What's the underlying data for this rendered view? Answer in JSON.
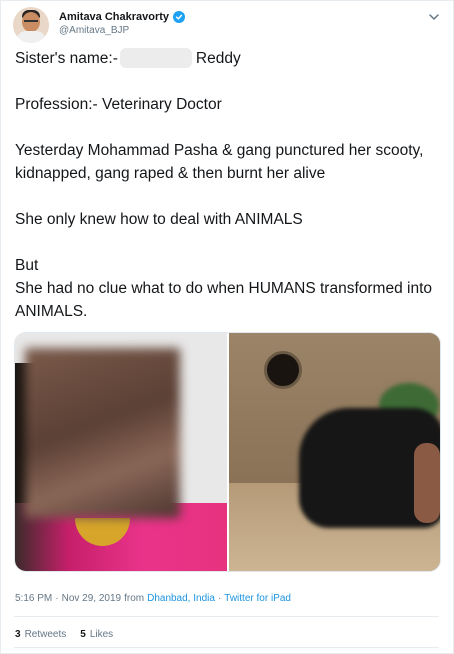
{
  "tweet": {
    "author": {
      "display_name": "Amitava Chakravorty",
      "handle": "@Amitava_BJP",
      "verified": true
    },
    "text": {
      "line1_prefix": "Sister's name:-",
      "line1_suffix": "Reddy",
      "line2": "Profession:- Veterinary Doctor",
      "line3": "Yesterday Mohammad Pasha & gang punctured her scooty, kidnapped, gang raped & then burnt her alive",
      "line4": "She only knew how to deal with ANIMALS",
      "line5": "But",
      "line6": "She had no clue what to do when HUMANS transformed into ANIMALS."
    },
    "meta": {
      "time": "5:16 PM",
      "date": "Nov 29, 2019",
      "from_label": "from",
      "location": "Dhanbad, India",
      "source": "Twitter for iPad"
    },
    "stats": {
      "retweets_count": "3",
      "retweets_label": "Retweets",
      "likes_count": "5",
      "likes_label": "Likes"
    }
  },
  "colors": {
    "link": "#1b95e0",
    "verified": "#1da1f2",
    "secondary_text": "#657786",
    "primary_text": "#14171a"
  },
  "icons": [
    "verified-badge-icon",
    "chevron-down-icon"
  ]
}
